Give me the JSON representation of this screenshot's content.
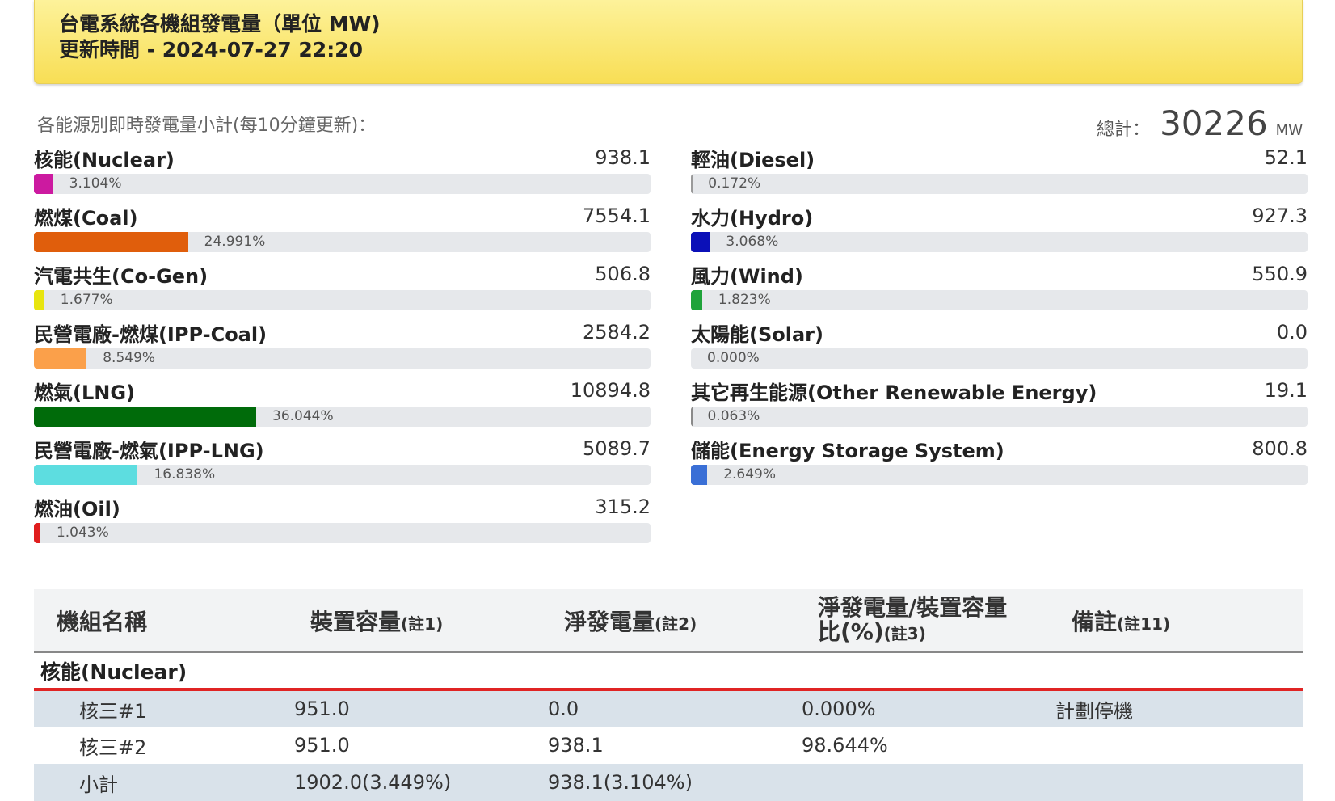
{
  "header": {
    "title": "台電系統各機組發電量（單位 MW)",
    "updated": "更新時間 - 2024-07-27 22:20"
  },
  "summary": {
    "caption": "各能源別即時發電量小計(每10分鐘更新)：",
    "total_label": "總計：",
    "total_value": "30226",
    "total_unit": "MW"
  },
  "sources_left": [
    {
      "name": "核能(Nuclear)",
      "value": "938.1",
      "pct": "3.104%",
      "share": 3.104,
      "color": "#cc1aa0"
    },
    {
      "name": "燃煤(Coal)",
      "value": "7554.1",
      "pct": "24.991%",
      "share": 24.991,
      "color": "#e05e0c"
    },
    {
      "name": "汽電共生(Co-Gen)",
      "value": "506.8",
      "pct": "1.677%",
      "share": 1.677,
      "color": "#e8e50f"
    },
    {
      "name": "民營電廠-燃煤(IPP-Coal)",
      "value": "2584.2",
      "pct": "8.549%",
      "share": 8.549,
      "color": "#fba04a"
    },
    {
      "name": "燃氣(LNG)",
      "value": "10894.8",
      "pct": "36.044%",
      "share": 36.044,
      "color": "#006b0a"
    },
    {
      "name": "民營電廠-燃氣(IPP-LNG)",
      "value": "5089.7",
      "pct": "16.838%",
      "share": 16.838,
      "color": "#5ddde0"
    },
    {
      "name": "燃油(Oil)",
      "value": "315.2",
      "pct": "1.043%",
      "share": 1.043,
      "color": "#e01e1e"
    }
  ],
  "sources_right": [
    {
      "name": "輕油(Diesel)",
      "value": "52.1",
      "pct": "0.172%",
      "share": 0.172,
      "color": "#9a9a9a"
    },
    {
      "name": "水力(Hydro)",
      "value": "927.3",
      "pct": "3.068%",
      "share": 3.068,
      "color": "#0b10b8"
    },
    {
      "name": "風力(Wind)",
      "value": "550.9",
      "pct": "1.823%",
      "share": 1.823,
      "color": "#1fa33a"
    },
    {
      "name": "太陽能(Solar)",
      "value": "0.0",
      "pct": "0.000%",
      "share": 0.0,
      "color": "#f5c518"
    },
    {
      "name": "其它再生能源(Other Renewable Energy)",
      "value": "19.1",
      "pct": "0.063%",
      "share": 0.063,
      "color": "#8a8a8a"
    },
    {
      "name": "儲能(Energy Storage System)",
      "value": "800.8",
      "pct": "2.649%",
      "share": 2.649,
      "color": "#3a6fd6"
    }
  ],
  "table": {
    "headers": {
      "name": "機組名稱",
      "capacity": "裝置容量",
      "capacity_note": "(註1)",
      "net": "淨發電量",
      "net_note": "(註2)",
      "ratio_line1": "淨發電量/裝置容量",
      "ratio_line2": "比(%)",
      "ratio_note": "(註3)",
      "remark": "備註",
      "remark_note": "(註11)"
    },
    "group": "核能(Nuclear)",
    "rows": [
      {
        "name": "核三#1",
        "capacity": "951.0",
        "net": "0.0",
        "ratio": "0.000%",
        "remark": "計劃停機"
      },
      {
        "name": "核三#2",
        "capacity": "951.0",
        "net": "938.1",
        "ratio": "98.644%",
        "remark": ""
      },
      {
        "name": "小計",
        "capacity": "1902.0(3.449%)",
        "net": "938.1(3.104%)",
        "ratio": "",
        "remark": ""
      }
    ]
  }
}
